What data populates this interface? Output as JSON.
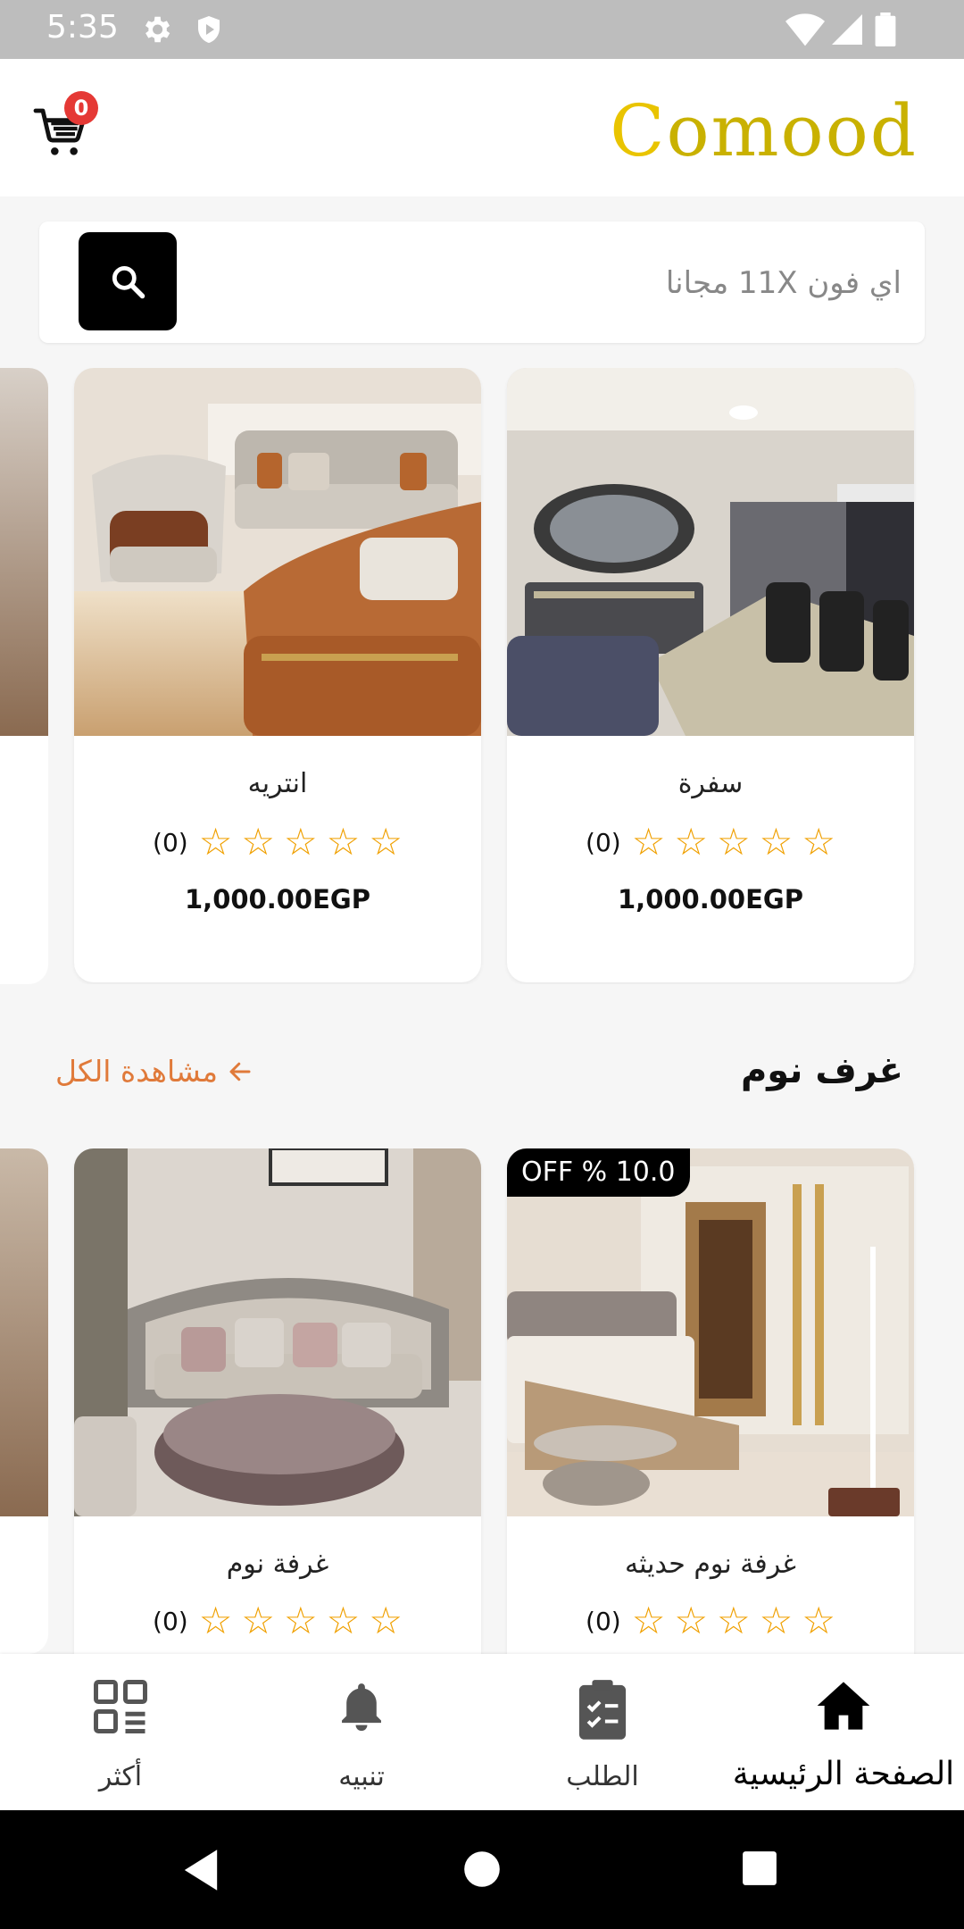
{
  "status_bar": {
    "time": "5:35",
    "icons": [
      "gear-icon",
      "shield-play-icon",
      "wifi-icon",
      "signal-icon",
      "battery-icon"
    ]
  },
  "header": {
    "brand": "Comood",
    "brand_initial": "C",
    "brand_rest": "omood",
    "cart_count": "0"
  },
  "search": {
    "placeholder": "اي فون 11X مجانا"
  },
  "row1": {
    "products": [
      {
        "name": "سفرة",
        "rating_count": "(0)",
        "price": "1,000.00EGP"
      },
      {
        "name": "انتريه",
        "rating_count": "(0)",
        "price": "1,000.00EGP"
      }
    ]
  },
  "section_bedrooms": {
    "title": "غرف نوم",
    "view_all": "مشاهدة الكل",
    "products": [
      {
        "name": "غرفة نوم حديثه",
        "rating_count": "(0)",
        "discount": "OFF % 10.0"
      },
      {
        "name": "غرفة نوم",
        "rating_count": "(0)"
      }
    ]
  },
  "bottom_nav": {
    "items": [
      {
        "label": "الصفحة الرئيسية",
        "icon": "home-icon",
        "active": true
      },
      {
        "label": "الطلب",
        "icon": "clipboard-icon",
        "active": false
      },
      {
        "label": "تنبيه",
        "icon": "bell-icon",
        "active": false
      },
      {
        "label": "أكثر",
        "icon": "grid-icon",
        "active": false
      }
    ]
  },
  "colors": {
    "accent": "#e07a3a",
    "star": "#f0a000",
    "brand": "#c9b100",
    "badge": "#e53935"
  }
}
